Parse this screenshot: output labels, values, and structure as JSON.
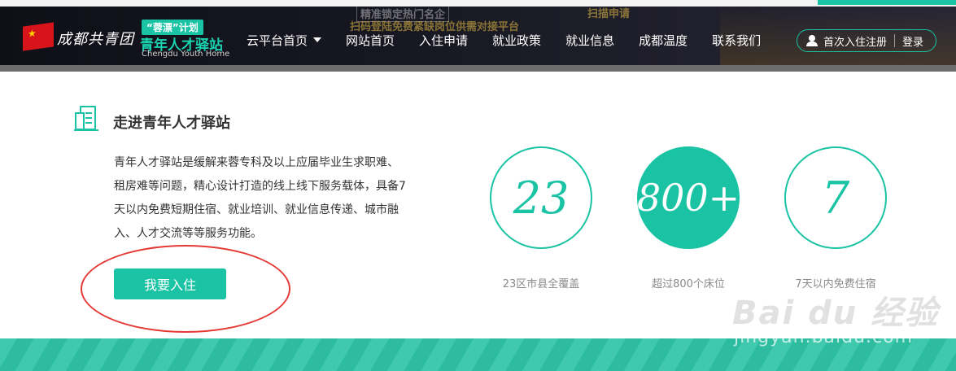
{
  "header": {
    "logo_text": "成都共青团",
    "brand": {
      "tag": "“蓉漂”计划",
      "name": "青年人才驿站",
      "english": "Chengdu Youth Home"
    },
    "banner_hints": [
      "精准锁定热门名企",
      "扫码登陆免费紧缺岗位供需对接平台",
      "扫描申请"
    ],
    "nav": [
      {
        "label": "云平台首页",
        "has_dropdown": true
      },
      {
        "label": "网站首页"
      },
      {
        "label": "入住申请"
      },
      {
        "label": "就业政策"
      },
      {
        "label": "就业信息"
      },
      {
        "label": "成都温度"
      },
      {
        "label": "联系我们"
      }
    ],
    "register_label": "首次入住注册",
    "login_label": "登录"
  },
  "main": {
    "section_title": "走进青年人才驿站",
    "description": "青年人才驿站是缓解来蓉专科及以上应届毕业生求职难、租房难等问题，精心设计打造的线上线下服务载体，具备7天以内免费短期住宿、就业培训、就业信息传递、城市融入、人才交流等等服务功能。",
    "cta_label": "我要入住",
    "stats": [
      {
        "value": "23",
        "label": "23区市县全覆盖",
        "filled": false
      },
      {
        "value": "800+",
        "label": "超过800个床位",
        "filled": true
      },
      {
        "value": "7",
        "label": "7天以内免费住宿",
        "filled": false
      }
    ]
  },
  "watermark": {
    "brand": "Bai du 经验",
    "url": "jingyan.baidu.com"
  },
  "colors": {
    "accent": "#19c3a4",
    "header_bg": "#171722",
    "annotation": "#e53935"
  }
}
